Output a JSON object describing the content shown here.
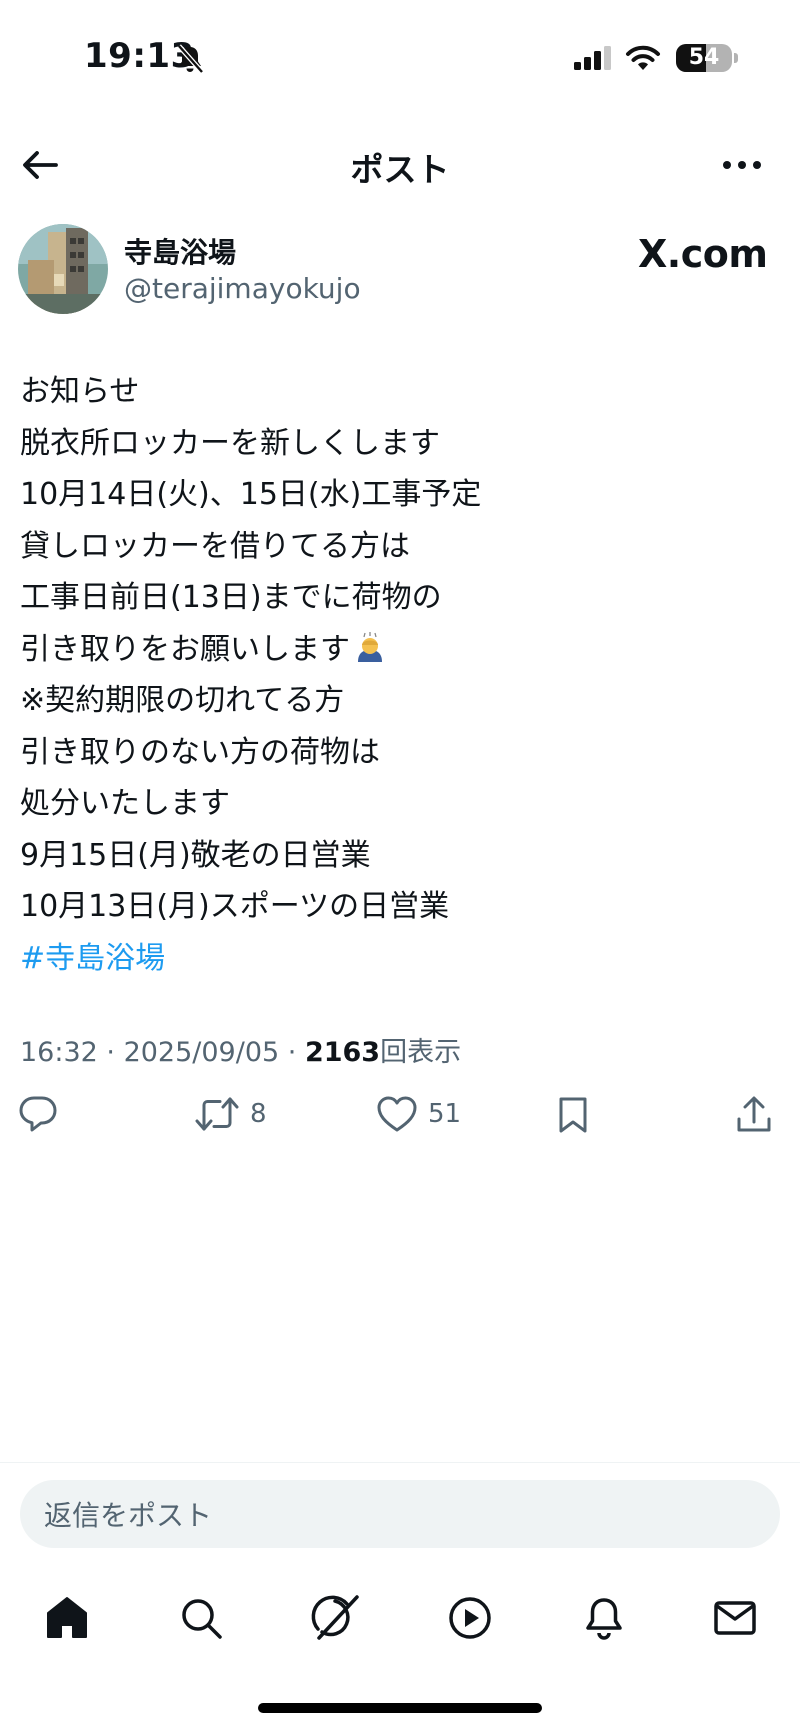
{
  "status_bar": {
    "time": "19:13",
    "battery": "54",
    "battery_level": 0.54
  },
  "header": {
    "title": "ポスト"
  },
  "author": {
    "display_name": "寺島浴場",
    "handle": "@terajimayokujo"
  },
  "watermark": "X.com",
  "post": {
    "lines": [
      "お知らせ",
      "脱衣所ロッカーを新しくします",
      "10月14日(火)、15日(水)工事予定",
      "貸しロッカーを借りてる方は",
      "工事日前日(13日)までに荷物の",
      "引き取りをお願いします",
      "※契約期限の切れてる方",
      "引き取りのない方の荷物は",
      "処分いたします",
      "9月15日(月)敬老の日営業",
      "10月13日(月)スポーツの日営業"
    ],
    "hashtag": "#寺島浴場"
  },
  "meta": {
    "time": "16:32",
    "sep1": " · ",
    "date": "2025/09/05",
    "sep2": " · ",
    "views": "2163",
    "views_label": "回表示"
  },
  "actions": {
    "retweets": "8",
    "likes": "51"
  },
  "reply": {
    "placeholder": "返信をポスト"
  },
  "icons": [
    "bell-slash-icon",
    "signal-icon",
    "wifi-icon",
    "battery-icon",
    "back-arrow-icon",
    "more-icon",
    "bowing-emoji-icon",
    "reply-icon",
    "retweet-icon",
    "like-icon",
    "bookmark-icon",
    "share-icon",
    "home-icon",
    "search-icon",
    "grok-icon",
    "video-icon",
    "notifications-icon",
    "messages-icon"
  ],
  "colors": {
    "text": "#0f1419",
    "secondary": "#536471",
    "link": "#1d9bf0",
    "reply_bg": "#eff3f4"
  }
}
